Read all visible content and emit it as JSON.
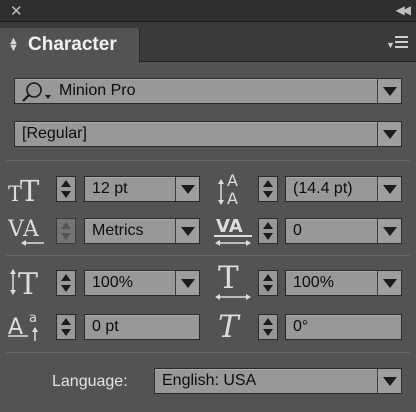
{
  "panel": {
    "title": "Character",
    "close_glyph": "✕",
    "collapse_glyph": "◀◀"
  },
  "font": {
    "family": "Minion Pro",
    "style": "[Regular]",
    "search_icon": "magnifier-icon"
  },
  "size": {
    "value": "12 pt",
    "icon": "font-size-icon"
  },
  "leading": {
    "value": "(14.4 pt)",
    "icon": "leading-icon"
  },
  "kerning": {
    "value": "Metrics",
    "icon": "kerning-icon"
  },
  "tracking": {
    "value": "0",
    "icon": "tracking-icon"
  },
  "vertical_scale": {
    "value": "100%",
    "icon": "vertical-scale-icon"
  },
  "horizontal_scale": {
    "value": "100%",
    "icon": "horizontal-scale-icon"
  },
  "baseline_shift": {
    "value": "0 pt",
    "icon": "baseline-shift-icon"
  },
  "skew": {
    "value": "0°",
    "icon": "skew-icon"
  },
  "language": {
    "label": "Language:",
    "value": "English: USA"
  },
  "colors": {
    "panel_bg": "#535353",
    "field_bg": "#989898",
    "field_text": "#0d0d0d",
    "label_text": "#e6e6e6"
  }
}
